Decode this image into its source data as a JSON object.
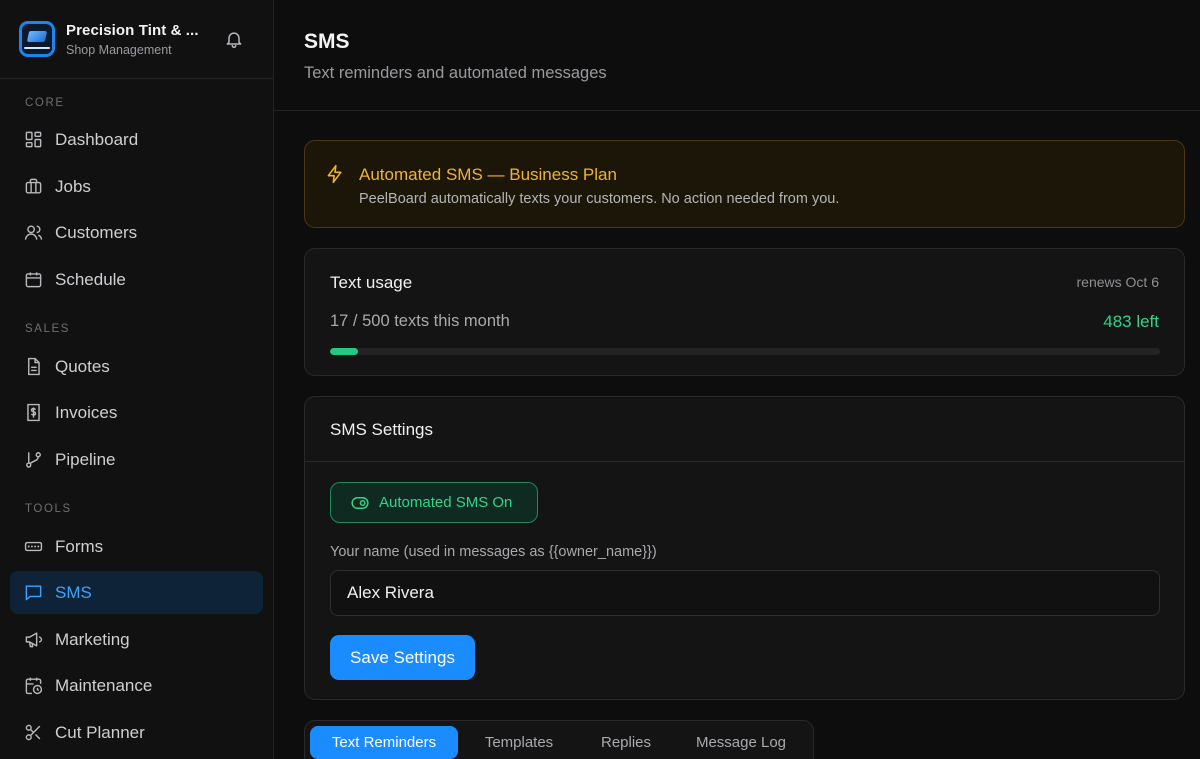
{
  "brand": {
    "name": "Precision Tint & ...",
    "subtitle": "Shop Management"
  },
  "sidebar": {
    "sections": [
      {
        "label": "CORE",
        "items": [
          {
            "label": "Dashboard",
            "icon": "dashboard-icon"
          },
          {
            "label": "Jobs",
            "icon": "briefcase-icon"
          },
          {
            "label": "Customers",
            "icon": "users-icon"
          },
          {
            "label": "Schedule",
            "icon": "calendar-icon"
          }
        ]
      },
      {
        "label": "SALES",
        "items": [
          {
            "label": "Quotes",
            "icon": "document-icon"
          },
          {
            "label": "Invoices",
            "icon": "invoice-icon"
          },
          {
            "label": "Pipeline",
            "icon": "git-branch-icon"
          }
        ]
      },
      {
        "label": "TOOLS",
        "items": [
          {
            "label": "Forms",
            "icon": "form-icon"
          },
          {
            "label": "SMS",
            "icon": "message-icon",
            "active": true
          },
          {
            "label": "Marketing",
            "icon": "megaphone-icon"
          },
          {
            "label": "Maintenance",
            "icon": "calendar-clock-icon"
          },
          {
            "label": "Cut Planner",
            "icon": "scissors-icon"
          }
        ]
      }
    ]
  },
  "header": {
    "title": "SMS",
    "subtitle": "Text reminders and automated messages"
  },
  "banner": {
    "title": "Automated SMS — Business Plan",
    "text": "PeelBoard automatically texts your customers. No action needed from you.",
    "icon": "bolt-icon",
    "color": "#f0b429"
  },
  "usage": {
    "title": "Text usage",
    "renews": "renews Oct 6",
    "count_text": "17 / 500 texts this month",
    "left_text": "483 left",
    "used": 17,
    "total": 500,
    "accent": "#22c983"
  },
  "settings": {
    "title": "SMS Settings",
    "toggle_label": "Automated SMS On",
    "name_label": "Your name (used in messages as {{owner_name}})",
    "name_value": "Alex Rivera",
    "save_label": "Save Settings"
  },
  "tabs": [
    {
      "label": "Text Reminders",
      "active": true
    },
    {
      "label": "Templates"
    },
    {
      "label": "Replies"
    },
    {
      "label": "Message Log"
    }
  ]
}
